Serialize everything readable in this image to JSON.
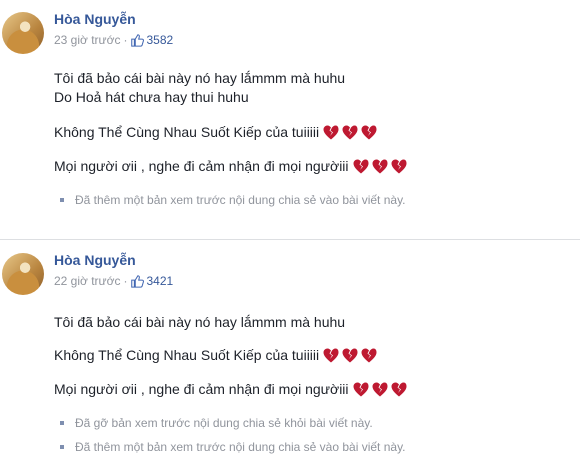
{
  "posts": [
    {
      "author": "Hòa Nguyễn",
      "time": "23 giờ trước",
      "separator": "·",
      "like_count": "3582",
      "lines": [
        "Tôi đã bảo cái bài này nó hay lắmmm mà huhu",
        "Do Hoả hát chưa hay thui huhu",
        "Không Thể Cùng Nhau Suốt Kiếp của tuiiiii",
        "Mọi người ơii , nghe đi cảm nhận đi mọi ngườiii"
      ],
      "notes": [
        "Đã thêm một bản xem trước nội dung chia sẻ vào bài viết này."
      ]
    },
    {
      "author": "Hòa Nguyễn",
      "time": "22 giờ trước",
      "separator": "·",
      "like_count": "3421",
      "lines": [
        "Tôi đã bảo cái bài này nó hay lắmmm mà huhu",
        "Không Thể Cùng Nhau Suốt Kiếp của tuiiiii",
        "Mọi người ơii , nghe đi cảm nhận đi mọi ngườiii"
      ],
      "notes": [
        "Đã gỡ bản xem trước nội dung chia sẻ khỏi bài viết này.",
        "Đã thêm một bản xem trước nội dung chia sẻ vào bài viết này."
      ]
    }
  ],
  "icons": {
    "like": "thumbs-up-icon",
    "heart": "broken-heart-icon",
    "bullet": "bullet-icon"
  },
  "colors": {
    "name": "#365899",
    "meta": "#90949c",
    "heart": "#be1931",
    "divider": "#dddfe2"
  }
}
